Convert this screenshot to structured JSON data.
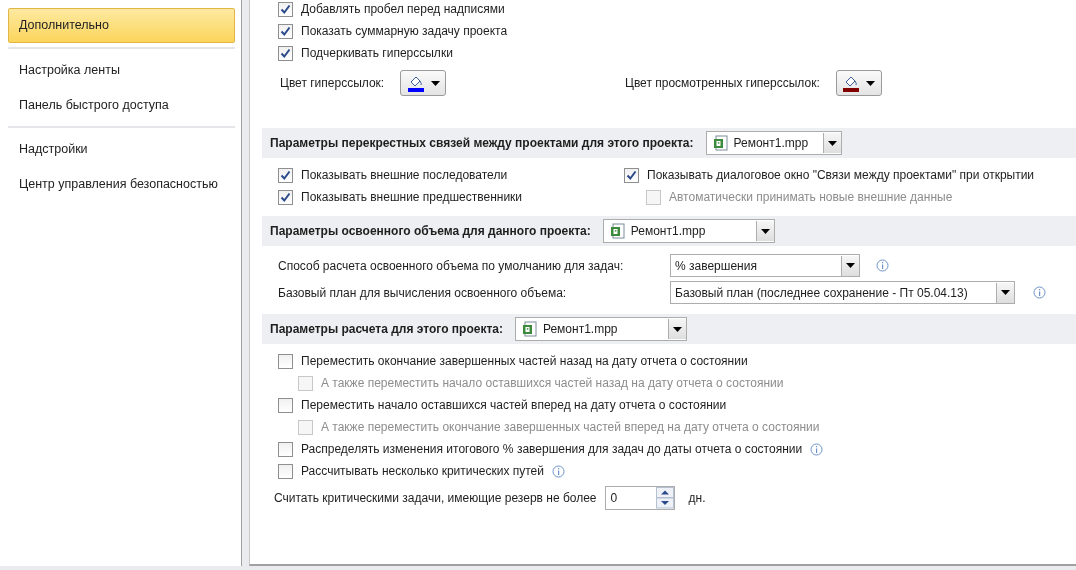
{
  "sidebar": {
    "groups": [
      [
        {
          "label": "Дополнительно",
          "selected": true
        }
      ],
      [
        {
          "label": "Настройка ленты",
          "selected": false
        },
        {
          "label": "Панель быстрого доступа",
          "selected": false
        }
      ],
      [
        {
          "label": "Надстройки",
          "selected": false
        },
        {
          "label": "Центр управления безопасностью",
          "selected": false
        }
      ]
    ]
  },
  "top_options": [
    {
      "label": "Добавлять пробел перед надписями",
      "checked": true
    },
    {
      "label": "Показать суммарную задачу проекта",
      "checked": true
    },
    {
      "label": "Подчеркивать гиперссылки",
      "checked": true
    }
  ],
  "hyperlink_colors": [
    {
      "label": "Цвет гиперссылок:",
      "color": "#0000ff"
    },
    {
      "label": "Цвет просмотренных гиперссылок:",
      "color": "#800000"
    }
  ],
  "sections": [
    {
      "title": "Параметры перекрестных связей между проектами для этого проекта:",
      "project": "Ремонт1.mpp",
      "columns": [
        [
          {
            "kind": "checkbox",
            "label": "Показывать внешние последователи",
            "checked": true,
            "disabled": false
          },
          {
            "kind": "checkbox",
            "label": "Показывать внешние предшественники",
            "checked": true,
            "disabled": false
          }
        ],
        [
          {
            "kind": "checkbox",
            "label": "Показывать диалоговое окно \"Связи между проектами\" при открытии",
            "checked": true,
            "disabled": false
          },
          {
            "kind": "checkbox",
            "label": "Автоматически принимать новые внешние данные",
            "checked": false,
            "disabled": true
          }
        ]
      ]
    },
    {
      "title": "Параметры освоенного объема для данного проекта:",
      "project": "Ремонт1.mpp",
      "items": [
        {
          "kind": "select",
          "label": "Способ расчета освоенного объема по умолчанию для задач:",
          "value": "% завершения",
          "info": true
        },
        {
          "kind": "select",
          "label": "Базовый план для вычисления освоенного объема:",
          "value": "Базовый план  (последнее сохранение - Пт 05.04.13)",
          "info": true
        }
      ]
    },
    {
      "title": "Параметры расчета для этого проекта:",
      "project": "Ремонт1.mpp",
      "items": [
        {
          "kind": "checkbox",
          "label": "Переместить окончание завершенных частей назад на дату отчета о состоянии",
          "checked": false,
          "disabled": false,
          "children": [
            {
              "kind": "checkbox",
              "label": "А также переместить начало оставшихся частей назад на дату отчета о состоянии",
              "checked": false,
              "disabled": true
            }
          ]
        },
        {
          "kind": "checkbox",
          "label": "Переместить начало оставшихся частей вперед на дату отчета о состоянии",
          "checked": false,
          "disabled": false,
          "children": [
            {
              "kind": "checkbox",
              "label": "А также переместить окончание завершенных частей вперед на дату отчета о состоянии",
              "checked": false,
              "disabled": true
            }
          ]
        },
        {
          "kind": "checkbox",
          "label": "Распределять изменения итогового % завершения для задач до даты отчета о состоянии",
          "checked": false,
          "disabled": false,
          "info": true
        },
        {
          "kind": "checkbox",
          "label": "Рассчитывать несколько критических путей",
          "checked": false,
          "disabled": false,
          "info": true
        },
        {
          "kind": "spin",
          "label": "Считать критическими задачи, имеющие резерв не более",
          "value": "0",
          "unit": "дн."
        }
      ]
    }
  ]
}
